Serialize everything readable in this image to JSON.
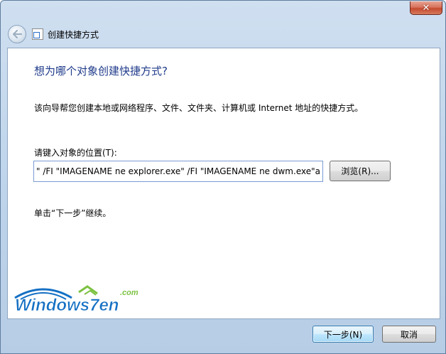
{
  "titlebar": {
    "close_symbol": "✕"
  },
  "nav": {
    "back_icon": "back-arrow-icon",
    "title": "创建快捷方式"
  },
  "main": {
    "heading": "想为哪个对象创建快捷方式?",
    "description": "该向导帮您创建本地或网络程序、文件、文件夹、计算机或 Internet 地址的快捷方式。",
    "field_label": "请键入对象的位置(T):",
    "location_value": "\" /FI \"IMAGENAME ne explorer.exe\" /FI \"IMAGENAME ne dwm.exe\"a",
    "browse_label": "浏览(R)...",
    "hint": "单击“下一步”继续。"
  },
  "watermark": {
    "text": "Windows7en",
    "suffix": ".com"
  },
  "footer": {
    "next_label": "下一步(N)",
    "cancel_label": "取消"
  },
  "colors": {
    "heading": "#1e3a8a",
    "frame": "#bcd3ea",
    "logo_blue": "#1570c4",
    "logo_green": "#7cc242"
  }
}
